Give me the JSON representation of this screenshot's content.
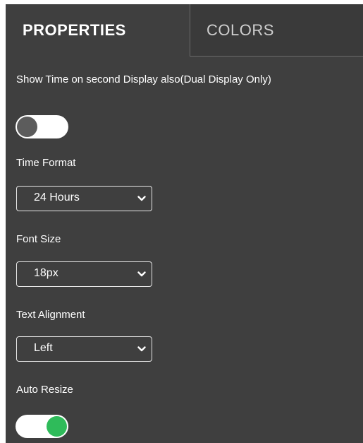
{
  "tabs": {
    "properties": "PROPERTIES",
    "colors": "COLORS"
  },
  "dual_display": {
    "label": "Show Time on second Display also(Dual Display Only)",
    "enabled": false
  },
  "time_format": {
    "label": "Time Format",
    "value": "24 Hours"
  },
  "font_size": {
    "label": "Font Size",
    "value": "18px"
  },
  "text_alignment": {
    "label": "Text Alignment",
    "value": "Left"
  },
  "auto_resize": {
    "label": "Auto Resize",
    "enabled": true
  },
  "colors": {
    "panel_background": "#3f3f3f",
    "toggle_on": "#2fbb5a",
    "toggle_off": "#5c5c5c"
  }
}
